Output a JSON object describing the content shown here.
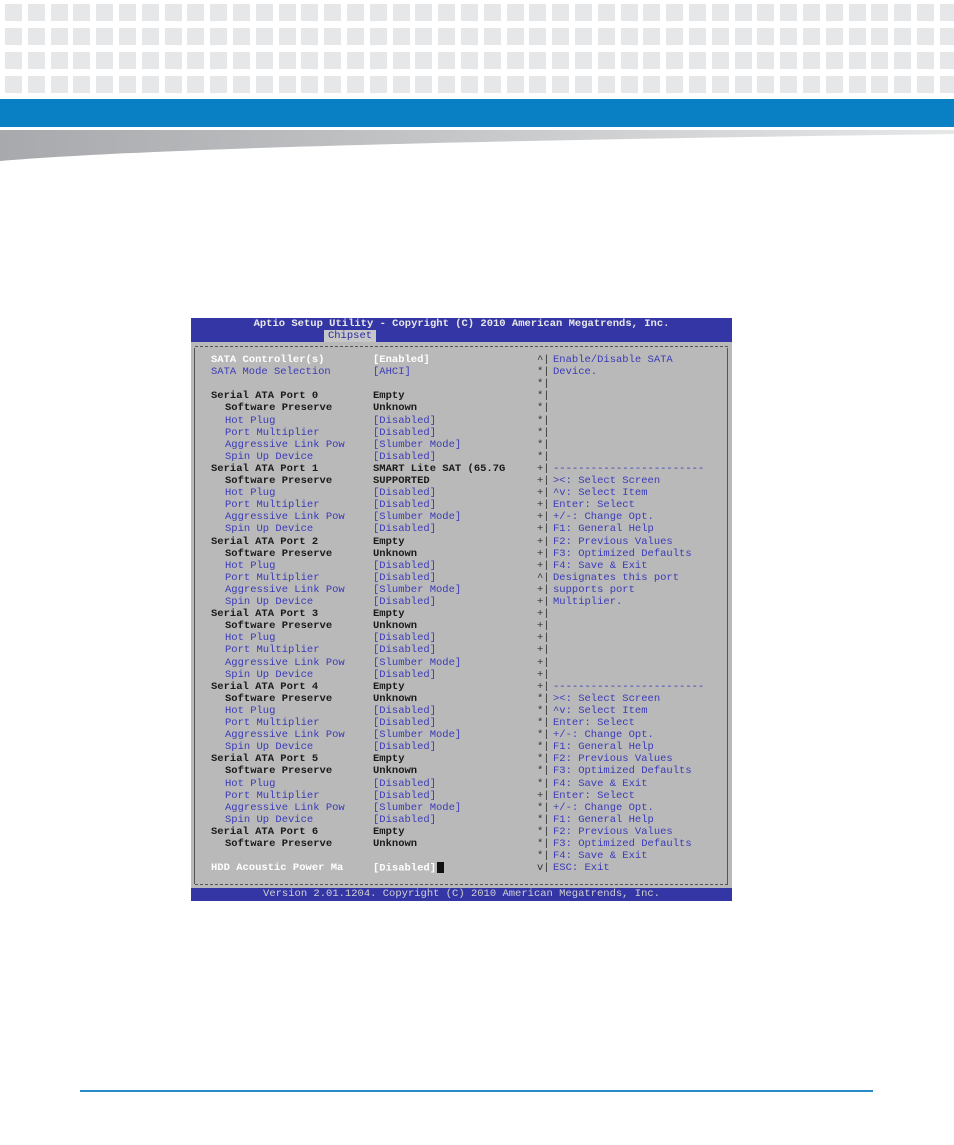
{
  "bios": {
    "title": "Aptio Setup Utility - Copyright (C) 2010 American Megatrends, Inc.",
    "active_tab": "Chipset",
    "footer": "Version 2.01.1204. Copyright (C) 2010 American Megatrends, Inc.",
    "settings": [
      {
        "label": "SATA Controller(s)",
        "value": "[Enabled]",
        "style": "sel",
        "indent": 0
      },
      {
        "label": "SATA Mode Selection",
        "value": "[AHCI]",
        "style": "blue",
        "indent": 0
      },
      {
        "label": "",
        "value": "",
        "style": "blue",
        "indent": 0
      },
      {
        "label": "Serial ATA Port 0",
        "value": "Empty",
        "style": "dark",
        "indent": 0
      },
      {
        "label": "Software Preserve",
        "value": "Unknown",
        "style": "dark",
        "indent": 1
      },
      {
        "label": "Hot Plug",
        "value": "[Disabled]",
        "style": "blue",
        "indent": 1
      },
      {
        "label": "Port Multiplier",
        "value": "[Disabled]",
        "style": "blue",
        "indent": 1
      },
      {
        "label": "Aggressive Link Pow",
        "value": "[Slumber Mode]",
        "style": "blue",
        "indent": 1
      },
      {
        "label": "Spin Up Device",
        "value": "[Disabled]",
        "style": "blue",
        "indent": 1
      },
      {
        "label": "Serial ATA Port 1",
        "value": "SMART Lite SAT (65.7G",
        "style": "dark",
        "indent": 0
      },
      {
        "label": "Software Preserve",
        "value": "SUPPORTED",
        "style": "dark",
        "indent": 1
      },
      {
        "label": "Hot Plug",
        "value": "[Disabled]",
        "style": "blue",
        "indent": 1
      },
      {
        "label": "Port Multiplier",
        "value": "[Disabled]",
        "style": "blue",
        "indent": 1
      },
      {
        "label": "Aggressive Link Pow",
        "value": "[Slumber Mode]",
        "style": "blue",
        "indent": 1
      },
      {
        "label": "Spin Up Device",
        "value": "[Disabled]",
        "style": "blue",
        "indent": 1
      },
      {
        "label": "Serial ATA Port 2",
        "value": "Empty",
        "style": "dark",
        "indent": 0
      },
      {
        "label": "Software Preserve",
        "value": "Unknown",
        "style": "dark",
        "indent": 1
      },
      {
        "label": "Hot Plug",
        "value": "[Disabled]",
        "style": "blue",
        "indent": 1
      },
      {
        "label": "Port Multiplier",
        "value": "[Disabled]",
        "style": "blue",
        "indent": 1
      },
      {
        "label": "Aggressive Link Pow",
        "value": "[Slumber Mode]",
        "style": "blue",
        "indent": 1
      },
      {
        "label": "Spin Up Device",
        "value": "[Disabled]",
        "style": "blue",
        "indent": 1
      },
      {
        "label": "Serial ATA Port 3",
        "value": "Empty",
        "style": "dark",
        "indent": 0
      },
      {
        "label": "Software Preserve",
        "value": "Unknown",
        "style": "dark",
        "indent": 1
      },
      {
        "label": "Hot Plug",
        "value": "[Disabled]",
        "style": "blue",
        "indent": 1
      },
      {
        "label": "Port Multiplier",
        "value": "[Disabled]",
        "style": "blue",
        "indent": 1
      },
      {
        "label": "Aggressive Link Pow",
        "value": "[Slumber Mode]",
        "style": "blue",
        "indent": 1
      },
      {
        "label": "Spin Up Device",
        "value": "[Disabled]",
        "style": "blue",
        "indent": 1
      },
      {
        "label": "Serial ATA Port 4",
        "value": "Empty",
        "style": "dark",
        "indent": 0
      },
      {
        "label": "Software Preserve",
        "value": "Unknown",
        "style": "dark",
        "indent": 1
      },
      {
        "label": "Hot Plug",
        "value": "[Disabled]",
        "style": "blue",
        "indent": 1
      },
      {
        "label": "Port Multiplier",
        "value": "[Disabled]",
        "style": "blue",
        "indent": 1
      },
      {
        "label": "Aggressive Link Pow",
        "value": "[Slumber Mode]",
        "style": "blue",
        "indent": 1
      },
      {
        "label": "Spin Up Device",
        "value": "[Disabled]",
        "style": "blue",
        "indent": 1
      },
      {
        "label": "Serial ATA Port 5",
        "value": "Empty",
        "style": "dark",
        "indent": 0
      },
      {
        "label": "Software Preserve",
        "value": "Unknown",
        "style": "dark",
        "indent": 1
      },
      {
        "label": "Hot Plug",
        "value": "[Disabled]",
        "style": "blue",
        "indent": 1
      },
      {
        "label": "Port Multiplier",
        "value": "[Disabled]",
        "style": "blue",
        "indent": 1
      },
      {
        "label": "Aggressive Link Pow",
        "value": "[Slumber Mode]",
        "style": "blue",
        "indent": 1
      },
      {
        "label": "Spin Up Device",
        "value": "[Disabled]",
        "style": "blue",
        "indent": 1
      },
      {
        "label": "Serial ATA Port 6",
        "value": "Empty",
        "style": "dark",
        "indent": 0
      },
      {
        "label": "Software Preserve",
        "value": "Unknown",
        "style": "dark",
        "indent": 1
      },
      {
        "label": "",
        "value": "",
        "style": "blue",
        "indent": 0
      },
      {
        "label": "HDD Acoustic Power Ma",
        "value": "[Disabled]",
        "style": "selend",
        "indent": 0
      }
    ],
    "scroll_marks": [
      "^",
      "*",
      "*",
      "*",
      "*",
      "*",
      "*",
      "*",
      "*",
      "+",
      "+",
      "+",
      "+",
      "+",
      "+",
      "+",
      "+",
      "+",
      "^",
      "+",
      "+",
      "+",
      "+",
      "+",
      "+",
      "+",
      "+",
      "+",
      "*",
      "*",
      "*",
      "*",
      "*",
      "*",
      "*",
      "*",
      "+",
      "*",
      "*",
      "*",
      "*",
      "*",
      "v"
    ],
    "help_lines": [
      "Enable/Disable SATA",
      "Device.",
      "",
      "",
      "",
      "",
      "",
      "",
      "",
      "------------------------",
      "><: Select Screen",
      "^v: Select Item",
      "Enter: Select",
      "+/-: Change Opt.",
      "F1: General Help",
      "F2: Previous Values",
      "F3: Optimized Defaults",
      "F4: Save & Exit",
      "Designates this port",
      "supports port",
      "Multiplier.",
      "",
      "",
      "",
      "",
      "",
      "",
      "------------------------",
      "><: Select Screen",
      "^v: Select Item",
      "Enter: Select",
      "+/-: Change Opt.",
      "F1: General Help",
      "F2: Previous Values",
      "F3: Optimized Defaults",
      "F4: Save & Exit",
      "Enter: Select",
      "+/-: Change Opt.",
      "F1: General Help",
      "F2: Previous Values",
      "F3: Optimized Defaults",
      "F4: Save & Exit",
      "ESC: Exit"
    ]
  }
}
